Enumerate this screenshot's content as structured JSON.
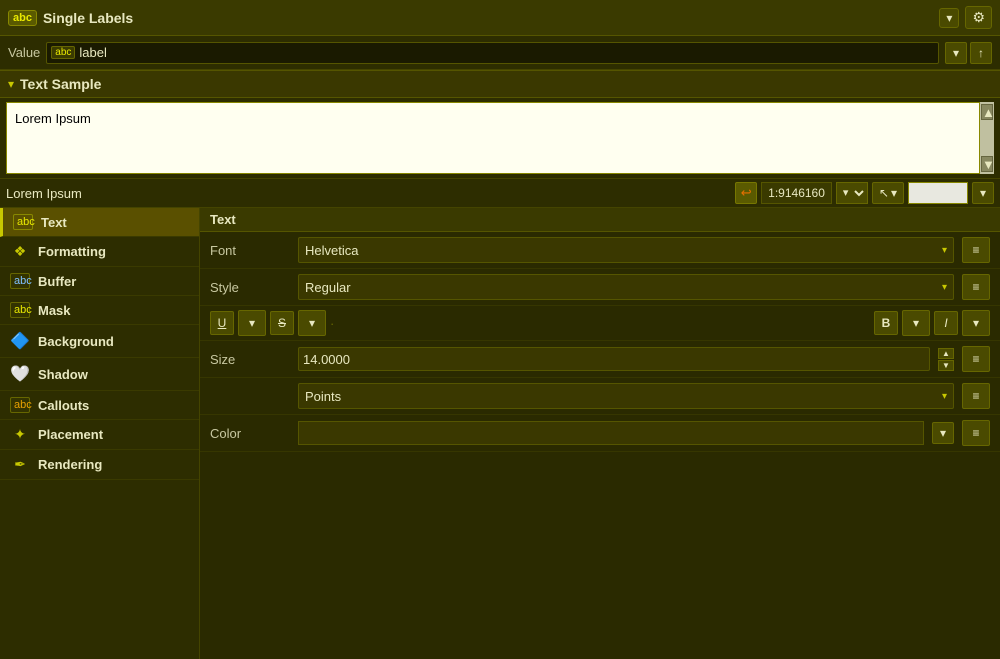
{
  "topbar": {
    "badge": "abc",
    "title": "Single Labels",
    "dropdown_arrow": "▾",
    "gear": "⚙"
  },
  "value_row": {
    "label": "Value",
    "abc_badge": "abc",
    "input_text": "label",
    "btn1": "▾",
    "btn2": "↑"
  },
  "text_sample": {
    "collapse_arrow": "▾",
    "title": "Text Sample",
    "preview_text": "Lorem Ipsum"
  },
  "bottom_toolbar": {
    "lorem_text": "Lorem Ipsum",
    "undo_icon": "↩",
    "coord": "1:9146160",
    "coord_dropdown": "▾",
    "cursor_btn": "↖",
    "cursor_dropdown": "▾"
  },
  "sidebar": {
    "items": [
      {
        "id": "text",
        "icon": "abc",
        "label": "Text",
        "active": true
      },
      {
        "id": "formatting",
        "icon": "❖",
        "label": "Formatting",
        "active": false
      },
      {
        "id": "buffer",
        "icon": "abc",
        "label": "Buffer",
        "active": false
      },
      {
        "id": "mask",
        "icon": "abc",
        "label": "Mask",
        "active": false
      },
      {
        "id": "background",
        "icon": "▣",
        "label": "Background",
        "active": false
      },
      {
        "id": "shadow",
        "icon": "◉",
        "label": "Shadow",
        "active": false
      },
      {
        "id": "callouts",
        "icon": "abc",
        "label": "Callouts",
        "active": false
      },
      {
        "id": "placement",
        "icon": "✦",
        "label": "Placement",
        "active": false
      },
      {
        "id": "rendering",
        "icon": "✒",
        "label": "Rendering",
        "active": false
      }
    ]
  },
  "right_panel": {
    "section_title": "Text",
    "properties": {
      "font_label": "Font",
      "font_value": "Helvetica",
      "style_label": "Style",
      "style_value": "Regular",
      "size_label": "Size",
      "size_value": "14.0000",
      "size_unit": "Points",
      "color_label": "Color"
    },
    "format_buttons": {
      "underline": "U",
      "strikethrough": "S",
      "bold": "B",
      "italic": "I"
    }
  },
  "icons": {
    "dropdown_list": "≡",
    "copy": "⧉"
  }
}
